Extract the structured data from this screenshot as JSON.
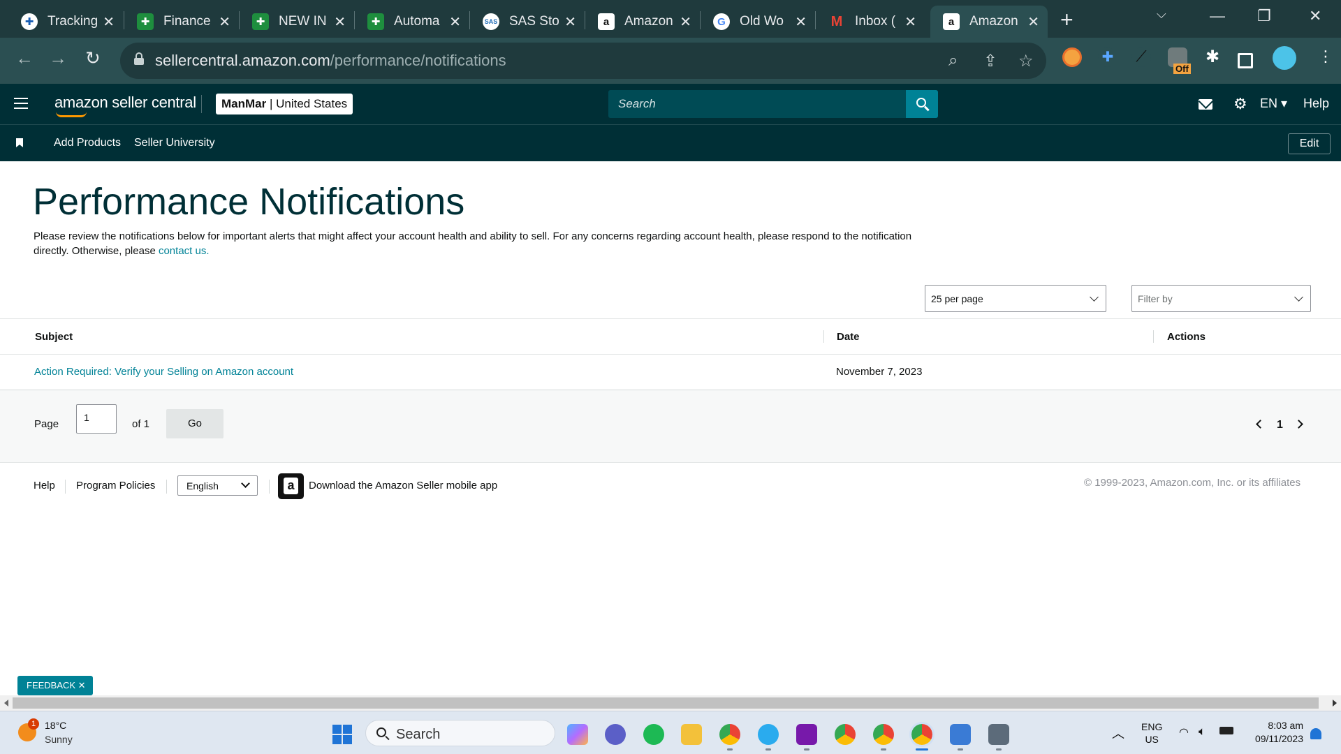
{
  "browser": {
    "tabs": [
      {
        "title": "Tracking",
        "favicon": "plus-circle-icon"
      },
      {
        "title": "Finance",
        "favicon": "sheets-icon"
      },
      {
        "title": "NEW IN",
        "favicon": "sheets-icon"
      },
      {
        "title": "Automa",
        "favicon": "sheets-icon"
      },
      {
        "title": "SAS Sto",
        "favicon": "sas-icon"
      },
      {
        "title": "Amazon",
        "favicon": "amazon-icon"
      },
      {
        "title": "Old Wo",
        "favicon": "google-icon"
      },
      {
        "title": "Inbox (",
        "favicon": "gmail-icon"
      },
      {
        "title": "Amazon",
        "favicon": "amazon-icon",
        "active": true
      }
    ],
    "url_domain": "sellercentral.amazon.com",
    "url_path": "/performance/notifications",
    "extension_badge": "Off"
  },
  "header": {
    "logo_text": "amazon seller central",
    "store_name": "ManMar",
    "store_region": "United States",
    "search_placeholder": "Search",
    "language": "EN",
    "help_label": "Help"
  },
  "subnav": {
    "links": [
      "Add Products",
      "Seller University"
    ],
    "edit_label": "Edit"
  },
  "page": {
    "title": "Performance Notifications",
    "intro": "Please review the notifications below for important alerts that might affect your account health and ability to sell. For any concerns regarding account health, please respond to the notification directly. Otherwise, please",
    "contact_link": "contact us.",
    "per_page": "25 per page",
    "filter_placeholder": "Filter by"
  },
  "table": {
    "columns": [
      "Subject",
      "Date",
      "Actions"
    ],
    "rows": [
      {
        "subject": "Action Required: Verify your Selling on Amazon account",
        "date": "November 7, 2023",
        "actions": ""
      }
    ]
  },
  "pagination": {
    "page_label": "Page",
    "page_value": "1",
    "of_label": "of 1",
    "go_label": "Go",
    "current_page": "1"
  },
  "footer": {
    "help": "Help",
    "program_policies": "Program Policies",
    "language": "English",
    "app_link": "Download the Amazon Seller mobile app",
    "copyright": "© 1999-2023, Amazon.com, Inc. or its affiliates"
  },
  "feedback": {
    "label": "FEEDBACK ✕"
  },
  "taskbar": {
    "weather_temp": "18°C",
    "weather_desc": "Sunny",
    "weather_badge": "1",
    "search_placeholder": "Search",
    "lang_line1": "ENG",
    "lang_line2": "US",
    "time": "8:03 am",
    "date": "09/11/2023"
  },
  "colors": {
    "header_bg": "#002f36",
    "link": "#008296",
    "accent_orange": "#ff9900"
  }
}
